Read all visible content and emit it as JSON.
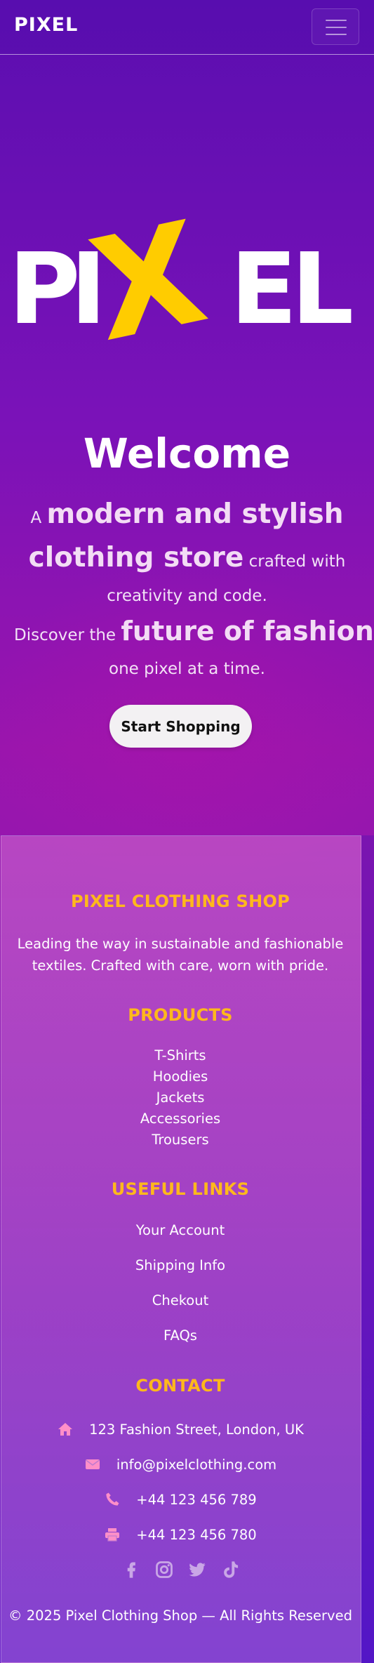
{
  "navbar": {
    "brand": "PIXEL",
    "toggle_icon": "hamburger-menu-icon"
  },
  "hero": {
    "logo_text": "PIXEL",
    "logo_letters": [
      "P",
      "I",
      "X",
      "E",
      "L"
    ],
    "logo_accent_color": "#ffcc00",
    "title": "Welcome",
    "line1_small": "A ",
    "line1_big": "modern and stylish",
    "line2_big": "clothing store",
    "line2_small": " crafted with",
    "line3": "creativity and code.",
    "line4_small": "Discover the ",
    "line4_big": "future of fashion",
    "line4_end": ",",
    "line5": "one pixel at a time.",
    "cta_label": "Start Shopping"
  },
  "footer": {
    "shop_heading": "PIXEL CLOTHING SHOP",
    "shop_text_1": "Leading the way in sustainable and fashionable",
    "shop_text_2": "textiles. Crafted with care, worn with pride.",
    "products_heading": "PRODUCTS",
    "products": [
      "T-Shirts",
      "Hoodies",
      "Jackets",
      "Accessories",
      "Trousers"
    ],
    "links_heading": "USEFUL LINKS",
    "links": [
      "Your Account",
      "Shipping Info",
      "Chekout",
      "FAQs"
    ],
    "contact_heading": "CONTACT",
    "contact": [
      {
        "icon": "home-icon",
        "text": "123 Fashion Street, London, UK"
      },
      {
        "icon": "envelope-icon",
        "text": "info@pixelclothing.com"
      },
      {
        "icon": "phone-icon",
        "text": "+44 123 456 789"
      },
      {
        "icon": "print-icon",
        "text": "+44 123 456 780"
      }
    ],
    "social_icons": [
      "facebook-icon",
      "instagram-icon",
      "twitter-icon",
      "tiktok-icon"
    ],
    "copyright": "© 2025 Pixel Clothing Shop — All Rights Reserved"
  },
  "colors": {
    "accent": "#ffb81c",
    "icon_pink": "#ff8fc8",
    "social_icon": "#c9a6e6"
  }
}
